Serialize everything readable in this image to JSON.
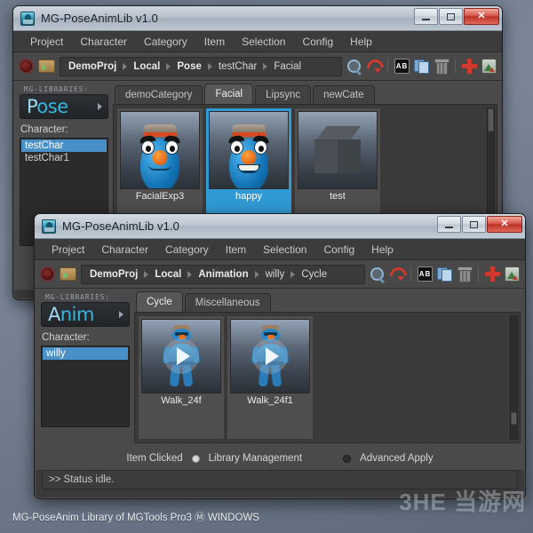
{
  "desktop": {
    "footer_text": "MG-PoseAnim Library of MGTools Pro3 Ⓜ WINDOWS",
    "watermark": "3HE 当游网",
    "collapse_handle": "›"
  },
  "menu": {
    "items": [
      "Project",
      "Character",
      "Category",
      "Item",
      "Selection",
      "Config",
      "Help"
    ]
  },
  "window_buttons": {
    "minimize": "–",
    "maximize": "▭",
    "close": "✕"
  },
  "toolbar_icons": [
    "record-icon",
    "open-folder-icon",
    "zoom-icon",
    "refresh-icon",
    "rename-ab-icon",
    "copy-icon",
    "delete-trash-icon",
    "add-plus-icon",
    "update-image-icon"
  ],
  "window1": {
    "title": "MG-PoseAnimLib v1.0",
    "breadcrumb": [
      {
        "label": "DemoProj",
        "bold": true
      },
      {
        "label": "Local",
        "bold": true
      },
      {
        "label": "Pose",
        "bold": true
      },
      {
        "label": "testChar",
        "bold": false
      },
      {
        "label": "Facial",
        "bold": false
      }
    ],
    "sidebar": {
      "caption": "MG-LIBRARIES:",
      "logo_first": "P",
      "logo_rest": "ose",
      "character_label": "Character:",
      "characters": [
        {
          "name": "testChar",
          "selected": true
        },
        {
          "name": "testChar1",
          "selected": false
        }
      ]
    },
    "tabs": [
      {
        "label": "demoCategory",
        "active": false
      },
      {
        "label": "Facial",
        "active": true
      },
      {
        "label": "Lipsync",
        "active": false
      },
      {
        "label": "newCate",
        "active": false
      }
    ],
    "items": [
      {
        "name": "FacialExp3",
        "selected": false,
        "art": "face-smile"
      },
      {
        "name": "happy",
        "selected": true,
        "art": "face-grin"
      },
      {
        "name": "test",
        "selected": false,
        "art": "cube"
      }
    ]
  },
  "window2": {
    "title": "MG-PoseAnimLib v1.0",
    "breadcrumb": [
      {
        "label": "DemoProj",
        "bold": true
      },
      {
        "label": "Local",
        "bold": true
      },
      {
        "label": "Animation",
        "bold": true
      },
      {
        "label": "willy",
        "bold": false
      },
      {
        "label": "Cycle",
        "bold": false
      }
    ],
    "sidebar": {
      "caption": "MG-LIBRARIES:",
      "logo_first": "A",
      "logo_rest": "nim",
      "character_label": "Character:",
      "characters": [
        {
          "name": "willy",
          "selected": true
        }
      ]
    },
    "tabs": [
      {
        "label": "Cycle",
        "active": true
      },
      {
        "label": "Miscellaneous",
        "active": false
      }
    ],
    "items": [
      {
        "name": "Walk_24f",
        "selected": false,
        "art": "walker"
      },
      {
        "name": "Walk_24f1",
        "selected": false,
        "art": "walker"
      }
    ],
    "options": {
      "item_clicked_label": "Item Clicked",
      "library_management_label": "Library Management",
      "library_management_on": true,
      "advanced_apply_label": "Advanced Apply",
      "advanced_apply_on": false
    },
    "status": ">> Status idle."
  },
  "colors": {
    "accent_blue": "#2f9ad4",
    "logo_cyan": "#35b6e0",
    "select_blue": "#4a90c8",
    "close_red": "#b93227",
    "panel_dark": "#3a3a3a"
  }
}
